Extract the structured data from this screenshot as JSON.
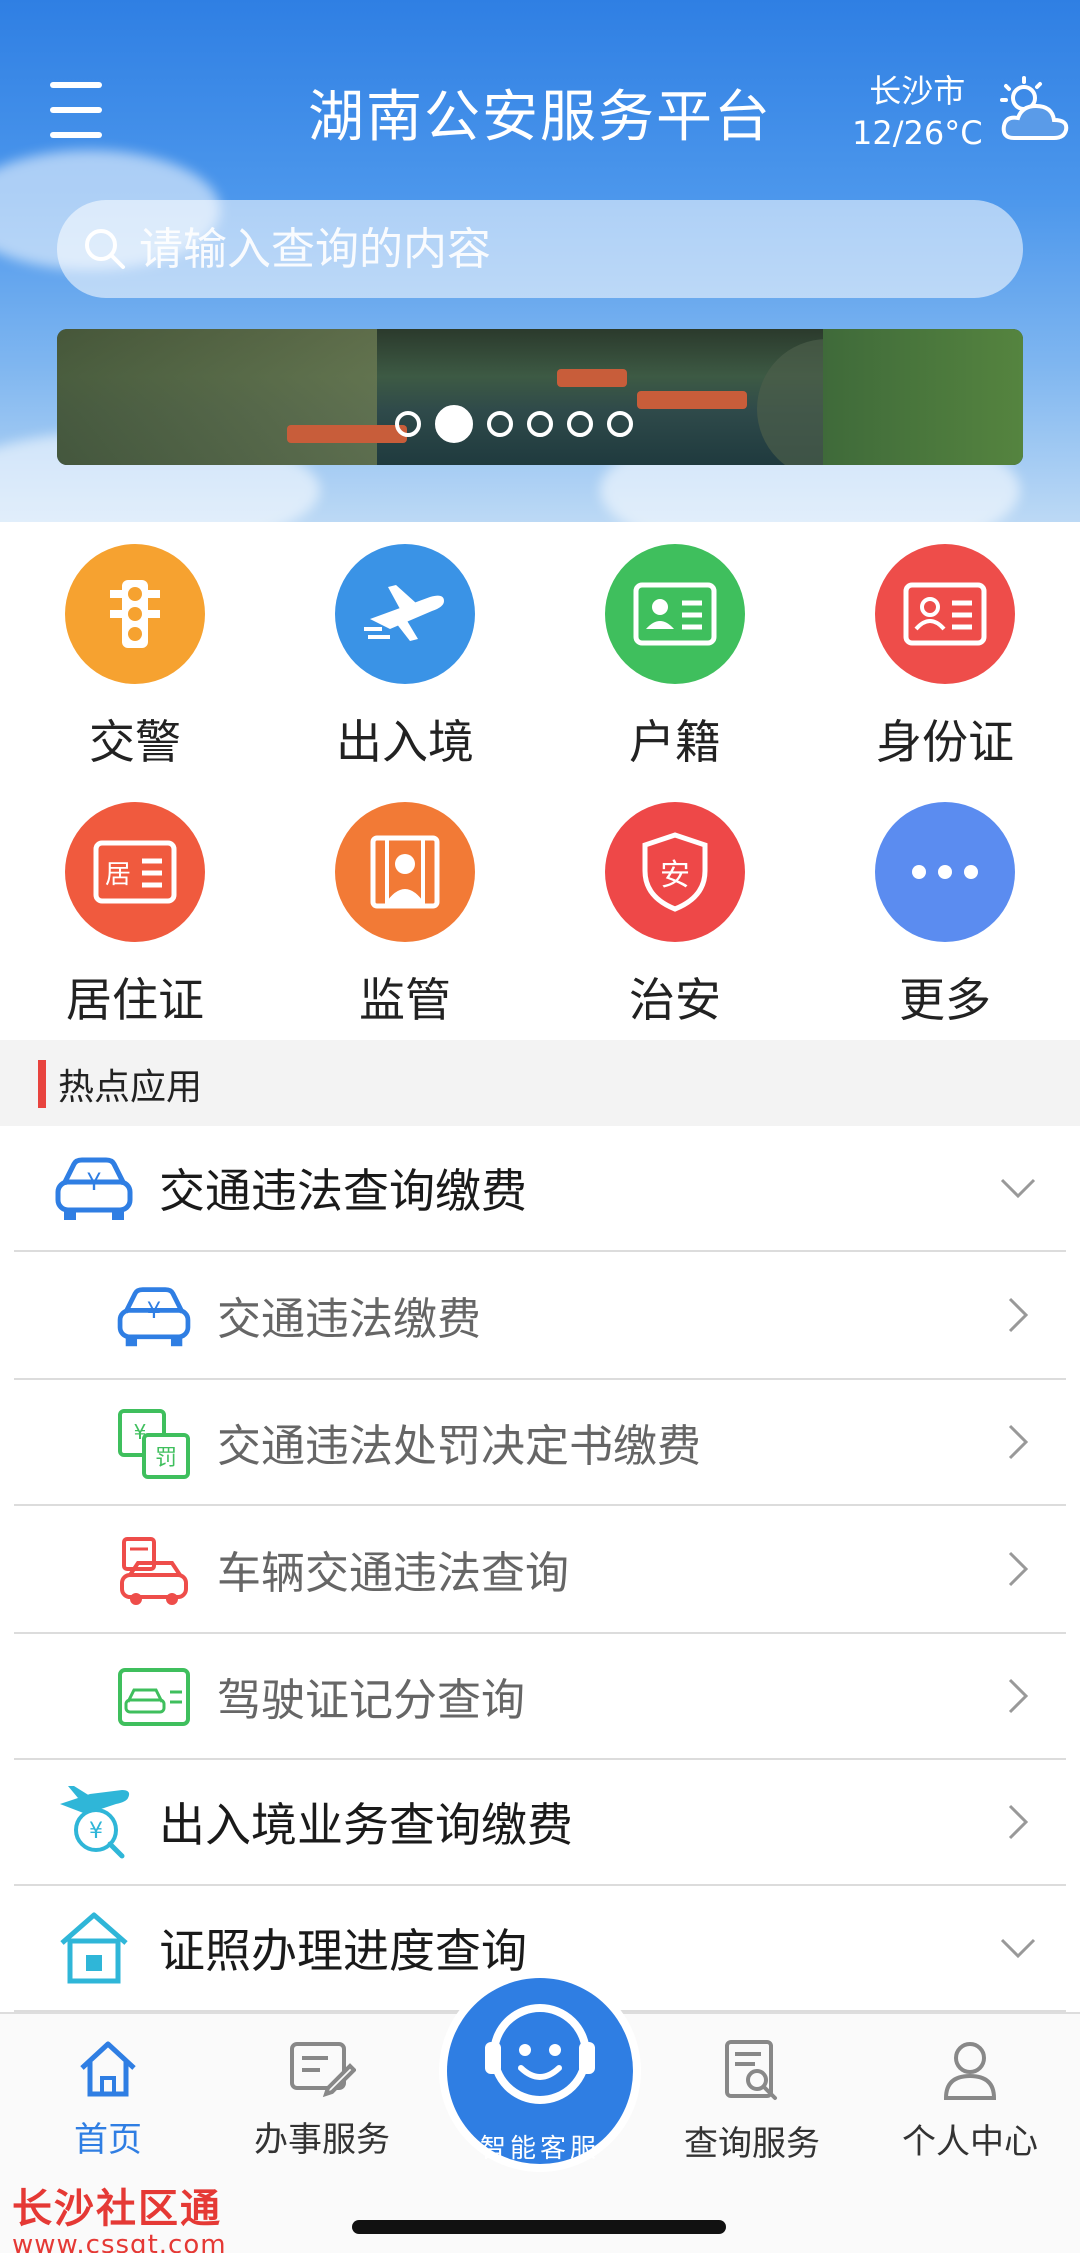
{
  "header": {
    "title": "湖南公安服务平台",
    "city": "长沙市",
    "temperature": "12/26°C",
    "weather_icon": "partly-cloudy-icon"
  },
  "search": {
    "placeholder": "请输入查询的内容"
  },
  "banner": {
    "slide_count": 6,
    "active_slide": 2
  },
  "grid": [
    {
      "label": "交警",
      "color": "#f6a230",
      "icon": "traffic-light-icon"
    },
    {
      "label": "出入境",
      "color": "#3a93e6",
      "icon": "airplane-icon"
    },
    {
      "label": "户籍",
      "color": "#3fbf5d",
      "icon": "household-card-icon"
    },
    {
      "label": "身份证",
      "color": "#ee4d4a",
      "icon": "id-card-icon"
    },
    {
      "label": "居住证",
      "color": "#f05a3e",
      "icon": "residence-card-icon"
    },
    {
      "label": "监管",
      "color": "#f27a36",
      "icon": "custody-icon"
    },
    {
      "label": "治安",
      "color": "#ee4848",
      "icon": "security-shield-icon"
    },
    {
      "label": "更多",
      "color": "#5b8cf0",
      "icon": "more-dots-icon"
    }
  ],
  "section": {
    "title": "热点应用"
  },
  "list": [
    {
      "label": "交通违法查询缴费",
      "level": "main",
      "chevron": "down",
      "icon": "car-yuan-icon"
    },
    {
      "label": "交通违法缴费",
      "level": "sub",
      "chevron": "right",
      "icon": "car-yuan-icon"
    },
    {
      "label": "交通违法处罚决定书缴费",
      "level": "sub",
      "chevron": "right",
      "icon": "penalty-notice-icon"
    },
    {
      "label": "车辆交通违法查询",
      "level": "sub",
      "chevron": "right",
      "icon": "car-clipboard-icon"
    },
    {
      "label": "驾驶证记分查询",
      "level": "sub",
      "chevron": "right",
      "icon": "driver-license-icon"
    },
    {
      "label": "出入境业务查询缴费",
      "level": "main",
      "chevron": "right",
      "icon": "plane-yuan-icon"
    },
    {
      "label": "证照办理进度查询",
      "level": "main",
      "chevron": "down",
      "icon": "house-icon"
    }
  ],
  "tabbar": {
    "home": "首页",
    "services": "办事服务",
    "assistant": "智能客服",
    "query": "查询服务",
    "profile": "个人中心"
  },
  "watermark": {
    "name": "长沙社区通",
    "url": "www.cssqt.com"
  }
}
